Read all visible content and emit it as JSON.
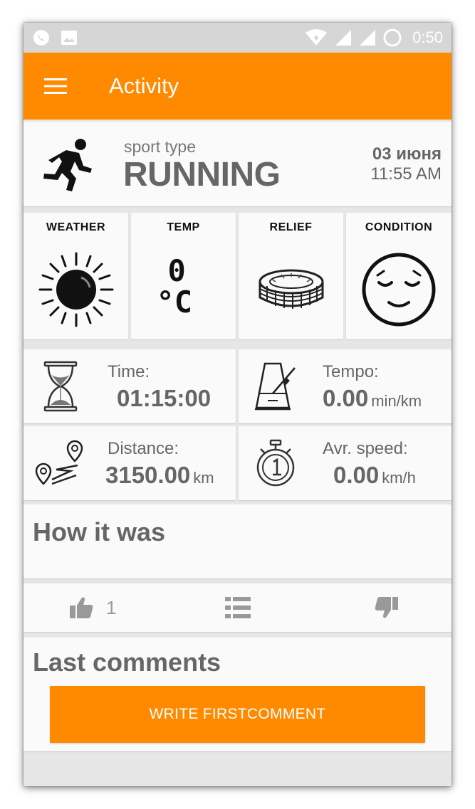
{
  "status_bar": {
    "time": "0:50",
    "icons": [
      "whatsapp-icon",
      "image-icon",
      "wifi-icon",
      "signal-icon",
      "signal-icon",
      "loading-circle-icon"
    ]
  },
  "app_bar": {
    "title": "Activity",
    "background": "#ff8a00"
  },
  "sport": {
    "label": "sport type",
    "value": "RUNNING",
    "date": "03 июня",
    "time": "11:55 AM",
    "icon": "runner-icon"
  },
  "conditions": [
    {
      "label": "WEATHER",
      "icon": "sun-icon"
    },
    {
      "label": "TEMP",
      "icon": "celsius-icon",
      "degree": "0",
      "unit": "°C"
    },
    {
      "label": "RELIEF",
      "icon": "stadium-icon"
    },
    {
      "label": "CONDITION",
      "icon": "calm-face-icon"
    }
  ],
  "stats": {
    "time": {
      "label": "Time:",
      "value": "01:15:00",
      "icon": "hourglass-icon"
    },
    "tempo": {
      "label": "Tempo:",
      "value": "0.00",
      "unit": "min/km",
      "icon": "metronome-icon"
    },
    "distance": {
      "label": "Distance:",
      "value": "3150.00",
      "unit": "km",
      "icon": "route-icon"
    },
    "speed": {
      "label": "Avr. speed:",
      "value": "0.00",
      "unit": "km/h",
      "icon": "stopwatch-icon"
    }
  },
  "review": {
    "title": "How it was"
  },
  "votes": {
    "likes": "1"
  },
  "comments": {
    "title": "Last comments",
    "button_label": "WRITE FIRSTCOMMENT"
  }
}
